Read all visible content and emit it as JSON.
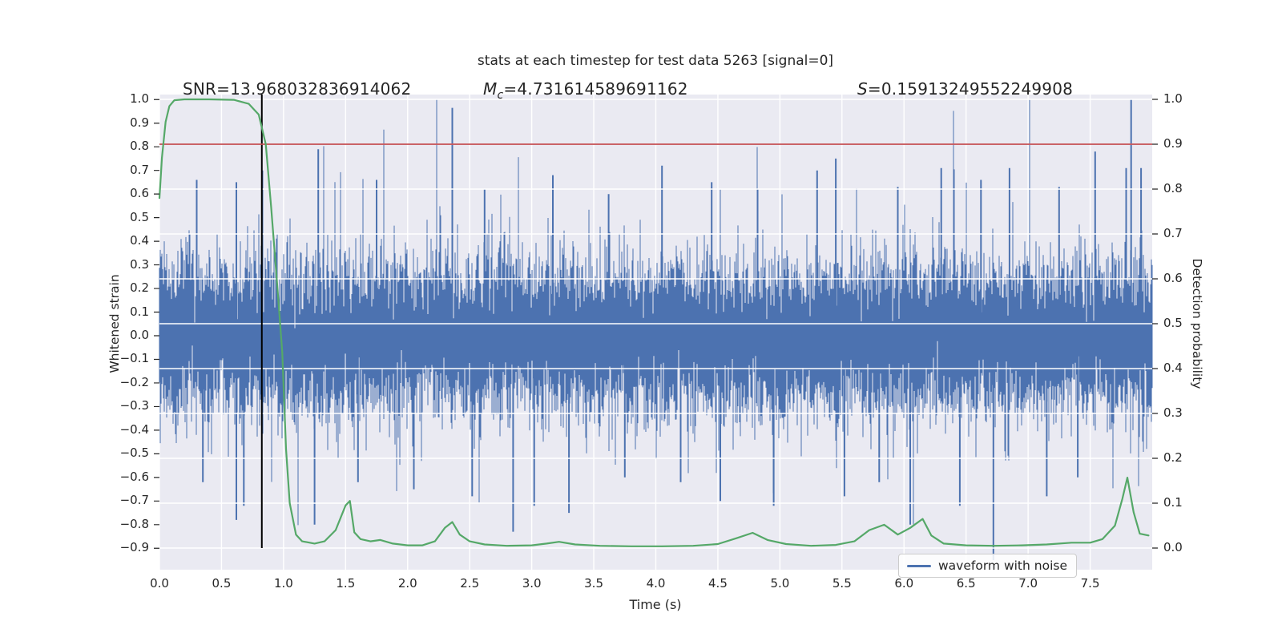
{
  "figure": {
    "title": "stats at each timestep for test data 5263 [signal=0]",
    "background": "#ffffff",
    "axes_background": "#eaeaf2",
    "grid_color": "#ffffff",
    "text_color": "#262626"
  },
  "annotations": {
    "snr": "SNR=13.968032836914062",
    "mc_var": "M",
    "mc_sub": "c",
    "mc_value": "=4.731614589691162",
    "s_var": "S",
    "s_value": "=0.15913249552249908"
  },
  "legend": {
    "label": "waveform with noise",
    "line_color": "#4c72b0"
  },
  "chart_data": {
    "type": "line",
    "title": "stats at each timestep for test data 5263 [signal=0]",
    "xlabel": "Time (s)",
    "ylabel_left": "Whitened strain",
    "ylabel_right": "Detection probability",
    "x_ticks": [
      "0.0",
      "0.5",
      "1.0",
      "1.5",
      "2.0",
      "2.5",
      "3.0",
      "3.5",
      "4.0",
      "4.5",
      "5.0",
      "5.5",
      "6.0",
      "6.5",
      "7.0",
      "7.5"
    ],
    "y_left_ticks": [
      "1.0",
      "0.9",
      "0.8",
      "0.7",
      "0.6",
      "0.5",
      "0.4",
      "0.3",
      "0.2",
      "0.1",
      "0.0",
      "−0.1",
      "−0.2",
      "−0.3",
      "−0.4",
      "−0.5",
      "−0.6",
      "−0.7",
      "−0.8",
      "−0.9"
    ],
    "y_right_ticks": [
      "1.0",
      "0.9",
      "0.8",
      "0.7",
      "0.6",
      "0.5",
      "0.4",
      "0.3",
      "0.2",
      "0.1",
      "0.0"
    ],
    "xlim": [
      0,
      8.0
    ],
    "ylim_left": [
      -0.995,
      1.02
    ],
    "ylim_right": [
      -0.048,
      1.011
    ],
    "grid": true,
    "legend_position": "lower right",
    "threshold_line": {
      "axis": "right",
      "value": 0.9,
      "color": "#c44e52"
    },
    "event_marker": {
      "time": 0.825,
      "color": "#000000",
      "span_right_axis": [
        0.0,
        1.011
      ]
    },
    "series": [
      {
        "name": "waveform with noise",
        "axis": "left",
        "color": "#4c72b0",
        "style": "dense_noise",
        "noise_sigma": 0.158,
        "samples_per_column": 13,
        "seed": 5263,
        "spikes_up": [
          [
            0.3,
            0.66
          ],
          [
            0.62,
            0.65
          ],
          [
            0.83,
            0.7
          ],
          [
            1.28,
            0.79
          ],
          [
            1.75,
            0.66
          ],
          [
            2.36,
            0.965
          ],
          [
            2.62,
            0.62
          ],
          [
            3.17,
            0.68
          ],
          [
            3.62,
            0.6
          ],
          [
            4.05,
            0.72
          ],
          [
            4.45,
            0.65
          ],
          [
            4.82,
            0.62
          ],
          [
            5.3,
            0.7
          ],
          [
            5.45,
            0.75
          ],
          [
            5.95,
            0.63
          ],
          [
            6.3,
            0.71
          ],
          [
            6.62,
            0.66
          ],
          [
            6.85,
            0.71
          ],
          [
            7.25,
            0.63
          ],
          [
            7.54,
            0.78
          ],
          [
            7.79,
            0.71
          ],
          [
            7.83,
            1.0
          ],
          [
            7.91,
            0.71
          ]
        ],
        "spikes_down": [
          [
            0.35,
            -0.62
          ],
          [
            0.62,
            -0.78
          ],
          [
            0.68,
            -0.72
          ],
          [
            1.25,
            -0.8
          ],
          [
            1.6,
            -0.62
          ],
          [
            2.05,
            -0.65
          ],
          [
            2.52,
            -0.68
          ],
          [
            2.85,
            -0.83
          ],
          [
            3.02,
            -0.72
          ],
          [
            3.3,
            -0.75
          ],
          [
            3.75,
            -0.6
          ],
          [
            4.2,
            -0.62
          ],
          [
            4.52,
            -0.7
          ],
          [
            4.95,
            -0.72
          ],
          [
            5.52,
            -0.68
          ],
          [
            5.8,
            -0.62
          ],
          [
            6.05,
            -0.8
          ],
          [
            6.45,
            -0.72
          ],
          [
            6.72,
            -0.95
          ],
          [
            7.15,
            -0.68
          ],
          [
            7.4,
            -0.6
          ]
        ]
      },
      {
        "name": "detection probability",
        "axis": "right",
        "color": "#55a868",
        "style": "line",
        "points": [
          [
            0.0,
            0.78
          ],
          [
            0.02,
            0.87
          ],
          [
            0.05,
            0.95
          ],
          [
            0.08,
            0.985
          ],
          [
            0.12,
            0.998
          ],
          [
            0.2,
            1.0
          ],
          [
            0.4,
            1.0
          ],
          [
            0.6,
            0.999
          ],
          [
            0.72,
            0.99
          ],
          [
            0.8,
            0.966
          ],
          [
            0.857,
            0.9
          ],
          [
            0.9,
            0.76
          ],
          [
            0.955,
            0.565
          ],
          [
            0.99,
            0.435
          ],
          [
            1.02,
            0.22
          ],
          [
            1.05,
            0.1
          ],
          [
            1.1,
            0.03
          ],
          [
            1.15,
            0.015
          ],
          [
            1.25,
            0.01
          ],
          [
            1.33,
            0.015
          ],
          [
            1.42,
            0.04
          ],
          [
            1.5,
            0.095
          ],
          [
            1.535,
            0.105
          ],
          [
            1.57,
            0.035
          ],
          [
            1.62,
            0.02
          ],
          [
            1.7,
            0.015
          ],
          [
            1.78,
            0.018
          ],
          [
            1.88,
            0.01
          ],
          [
            2.0,
            0.006
          ],
          [
            2.12,
            0.006
          ],
          [
            2.22,
            0.015
          ],
          [
            2.3,
            0.045
          ],
          [
            2.36,
            0.058
          ],
          [
            2.42,
            0.03
          ],
          [
            2.5,
            0.015
          ],
          [
            2.62,
            0.008
          ],
          [
            2.8,
            0.005
          ],
          [
            3.0,
            0.006
          ],
          [
            3.12,
            0.01
          ],
          [
            3.22,
            0.014
          ],
          [
            3.35,
            0.008
          ],
          [
            3.55,
            0.005
          ],
          [
            3.8,
            0.004
          ],
          [
            4.05,
            0.004
          ],
          [
            4.3,
            0.005
          ],
          [
            4.5,
            0.009
          ],
          [
            4.65,
            0.022
          ],
          [
            4.78,
            0.034
          ],
          [
            4.9,
            0.018
          ],
          [
            5.05,
            0.009
          ],
          [
            5.25,
            0.005
          ],
          [
            5.45,
            0.007
          ],
          [
            5.6,
            0.015
          ],
          [
            5.72,
            0.04
          ],
          [
            5.84,
            0.052
          ],
          [
            5.95,
            0.03
          ],
          [
            6.05,
            0.045
          ],
          [
            6.15,
            0.065
          ],
          [
            6.22,
            0.028
          ],
          [
            6.32,
            0.01
          ],
          [
            6.5,
            0.006
          ],
          [
            6.72,
            0.005
          ],
          [
            6.95,
            0.006
          ],
          [
            7.15,
            0.008
          ],
          [
            7.35,
            0.012
          ],
          [
            7.5,
            0.012
          ],
          [
            7.6,
            0.02
          ],
          [
            7.7,
            0.05
          ],
          [
            7.76,
            0.11
          ],
          [
            7.8,
            0.157
          ],
          [
            7.85,
            0.08
          ],
          [
            7.9,
            0.032
          ],
          [
            7.97,
            0.028
          ]
        ]
      }
    ]
  }
}
